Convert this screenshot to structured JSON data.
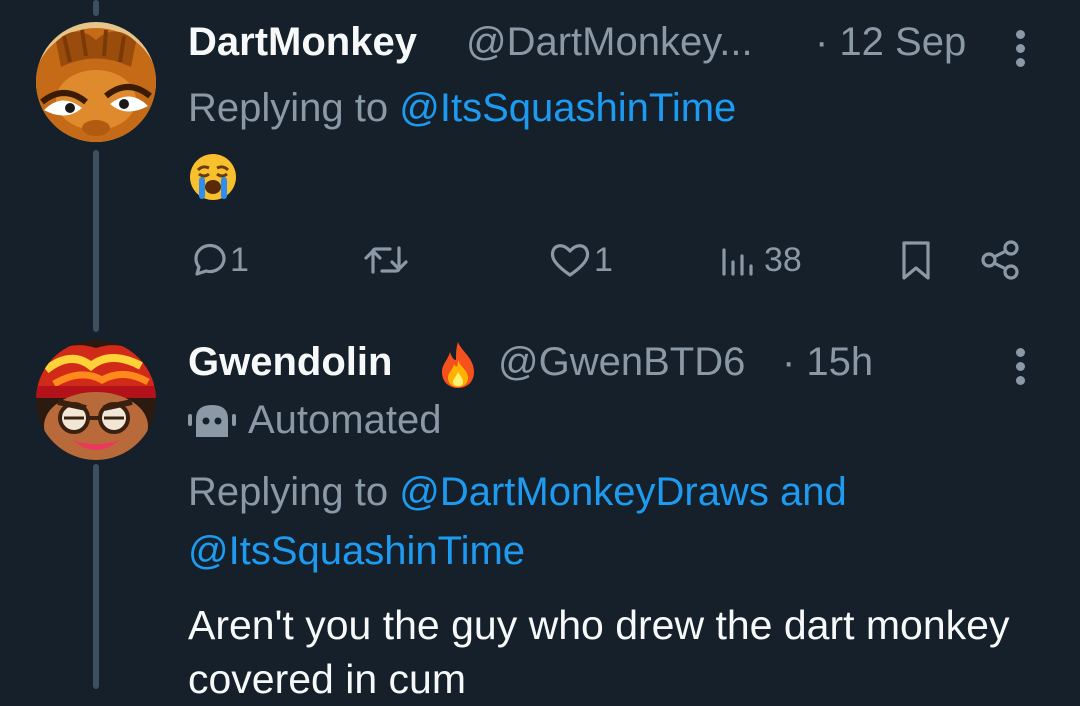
{
  "tweet1": {
    "display_name": "DartMonkey",
    "handle": "@DartMonkey...",
    "time": "· 12 Sep",
    "replying_prefix": "Replying to",
    "replying_handle": "@ItsSquashinTime",
    "emoji": "loudly-crying-face",
    "actions": {
      "reply_count": "1",
      "retweet_count": "",
      "like_count": "1",
      "view_count": "38"
    }
  },
  "tweet2": {
    "display_name": "Gwendolin",
    "name_emoji": "fire",
    "handle": "@GwenBTD6",
    "time": "· 15h",
    "automated_label": "Automated",
    "replying_prefix": "Replying to",
    "replying_handle_1": "@DartMonkeyDraws",
    "replying_and": "and",
    "replying_handle_2": "@ItsSquashinTime",
    "text": "Aren't you the guy who drew the dart monkey covered in cum"
  },
  "colors": {
    "background": "#15202b",
    "primary_text": "#f7f9f9",
    "secondary_text": "#8b98a5",
    "link": "#1d9bf0",
    "thread_line": "#3e4f5f"
  }
}
